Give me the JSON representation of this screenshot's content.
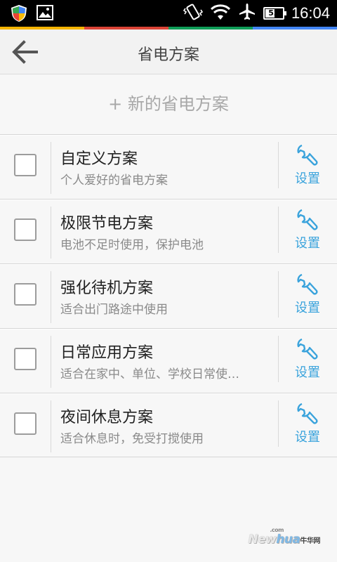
{
  "statusbar": {
    "time": "16:04",
    "battery_level": "52",
    "icons": [
      "shield-icon",
      "image-icon",
      "vibrate-icon",
      "wifi-icon",
      "airplane-icon",
      "battery-icon"
    ],
    "stripe_colors": [
      "#f4b400",
      "#db4437",
      "#0f9d58",
      "#4285f4"
    ]
  },
  "header": {
    "title": "省电方案",
    "back_icon": "back-arrow-icon"
  },
  "new_plan": {
    "label": "+ 新的省电方案"
  },
  "plans": [
    {
      "title": "自定义方案",
      "subtitle": "个人爱好的省电方案",
      "setting_label": "设置",
      "checked": false
    },
    {
      "title": "极限节电方案",
      "subtitle": "电池不足时使用，保护电池",
      "setting_label": "设置",
      "checked": false
    },
    {
      "title": "强化待机方案",
      "subtitle": "适合出门路途中使用",
      "setting_label": "设置",
      "checked": false
    },
    {
      "title": "日常应用方案",
      "subtitle": "适合在家中、单位、学校日常使…",
      "setting_label": "设置",
      "checked": false
    },
    {
      "title": "夜间休息方案",
      "subtitle": "适合休息时，免受打搅使用",
      "setting_label": "设置",
      "checked": false
    }
  ],
  "watermark": {
    "new": "New",
    "hua": "hua",
    "cn": "牛华网",
    "com": ".com"
  },
  "colors": {
    "accent": "#3aa3dc"
  }
}
